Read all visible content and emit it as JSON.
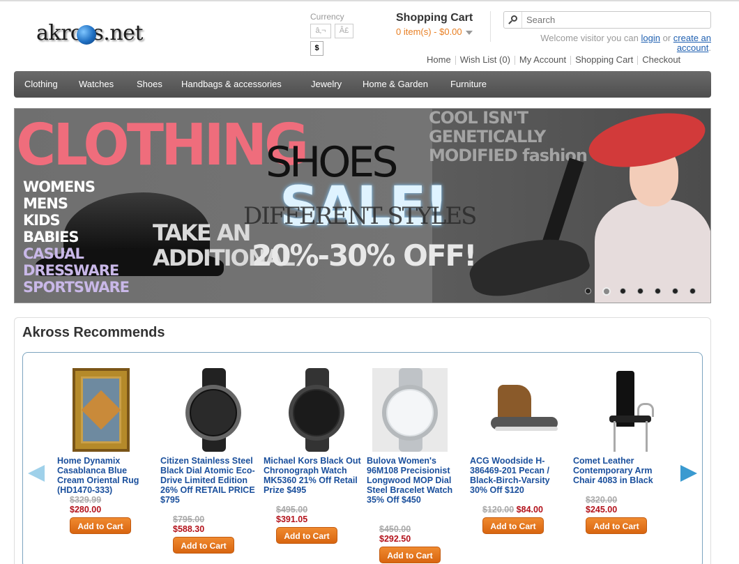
{
  "header": {
    "logo_text": "akross.net",
    "currency_label": "Currency",
    "currency_options": [
      "â‚¬",
      "Â£",
      "$"
    ],
    "cart_title": "Shopping Cart",
    "cart_summary": "0 item(s) - $0.00",
    "search_placeholder": "Search",
    "welcome_prefix": "Welcome visitor you can",
    "login_link": "login",
    "welcome_or": "or",
    "create_account_link": "create an account",
    "toplinks": [
      "Home",
      "Wish List (0)",
      "My Account",
      "Shopping Cart",
      "Checkout"
    ]
  },
  "nav": {
    "items": [
      "Clothing",
      "Watches",
      "Shoes",
      "Handbags & accessories",
      "Jewelry",
      "Home & Garden",
      "Furniture"
    ]
  },
  "banner": {
    "headline": "CLOTHING",
    "categories": [
      "WOMENS",
      "MENS",
      "KIDS",
      "BABIES",
      "CASUAL",
      "DRESSWARE",
      "SPORTSWARE"
    ],
    "take_line1": "TAKE AN",
    "take_line2": "ADDITIONAL",
    "shoes_text": "SHOES",
    "sale_text": "SALE!",
    "styles_text": "DIFFERENT STYLES",
    "off_text": "20%-30% OFF!",
    "right_text": "COOL ISN'T GENETICALLY MODIFIED fashion",
    "slide_count": 7,
    "active_slide": 2
  },
  "recommends": {
    "title": "Akross Recommends",
    "add_to_cart_label": "Add to Cart",
    "products": [
      {
        "name": "Home Dynamix Casablanca Blue Cream Oriental Rug (HD1470-333)",
        "old_price": "$329.99",
        "new_price": "$280.00"
      },
      {
        "name": "Citizen Stainless Steel Black Dial Atomic Eco-Drive Limited Edition 26% Off RETAIL PRICE $795",
        "old_price": "$795.00",
        "new_price": "$588.30"
      },
      {
        "name": "Michael Kors Black Out Chronograph Watch MK5360 21% Off Retail Prize $495",
        "old_price": "$495.00",
        "new_price": "$391.05"
      },
      {
        "name": "Bulova Women's 96M108 Precisionist Longwood MOP Dial Steel Bracelet Watch 35% Off $450",
        "old_price": "$450.00",
        "new_price": "$292.50"
      },
      {
        "name": "ACG Woodside H-386469-201 Pecan / Black-Birch-Varsity 30% Off $120",
        "old_price": "$120.00",
        "new_price": "$84.00"
      },
      {
        "name": "Comet Leather Contemporary Arm Chair 4083 in Black",
        "old_price": "$320.00",
        "new_price": "$245.00"
      }
    ]
  }
}
